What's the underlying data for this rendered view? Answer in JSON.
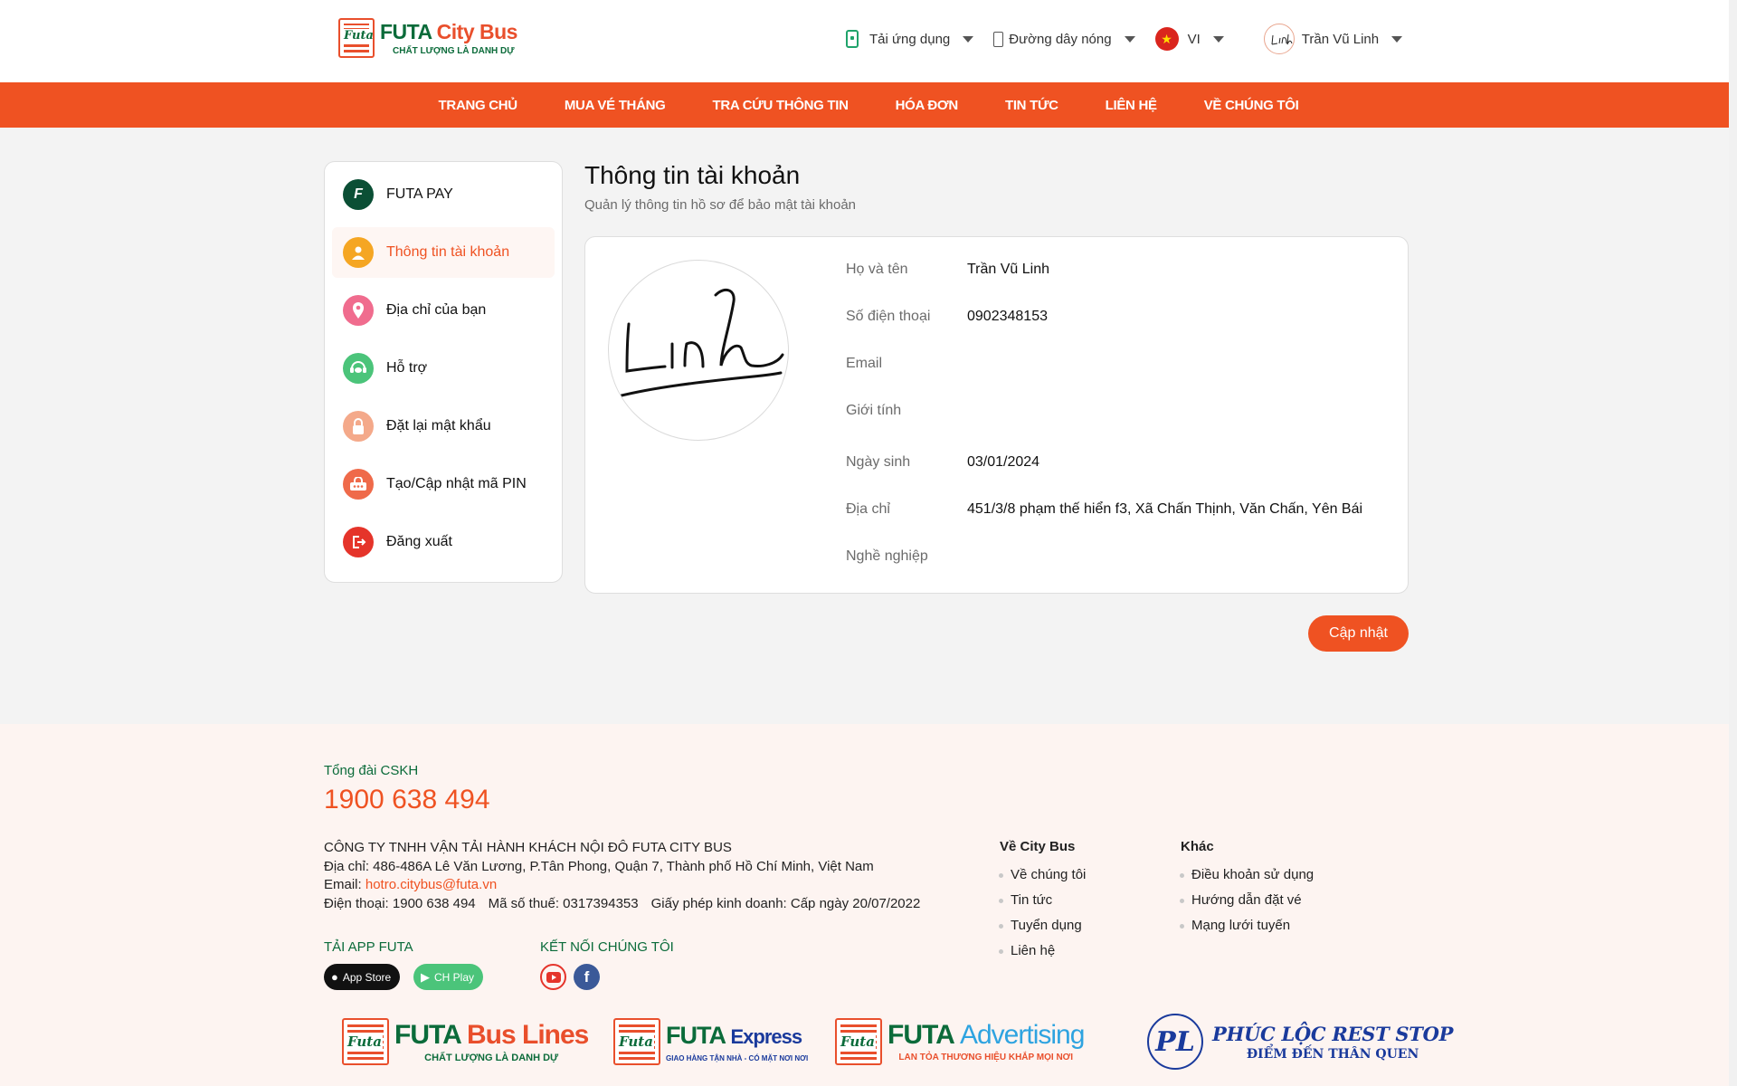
{
  "brand": {
    "logo_text": "Futa",
    "title_part1": "FUTA",
    "title_part2": "City Bus",
    "tagline": "CHẤT LƯỢNG LÀ DANH DỰ"
  },
  "topbar": {
    "app_download": "Tải ứng dụng",
    "hotline": "Đường dây nóng",
    "language": "VI",
    "user_name": "Trần Vũ Linh"
  },
  "nav": [
    "TRANG CHỦ",
    "MUA VÉ THÁNG",
    "TRA CỨU THÔNG TIN",
    "HÓA ĐƠN",
    "TIN TỨC",
    "LIÊN HỆ",
    "VỀ CHÚNG TÔI"
  ],
  "sidebar": [
    {
      "label": "FUTA PAY",
      "icon": "futa-pay-icon",
      "color": "#0b4f35"
    },
    {
      "label": "Thông tin tài khoản",
      "icon": "user-icon",
      "color": "#f5a623",
      "active": true
    },
    {
      "label": "Địa chỉ của bạn",
      "icon": "location-pin-icon",
      "color": "#f06c8e"
    },
    {
      "label": "Hỗ trợ",
      "icon": "support-chat-icon",
      "color": "#4bc47a"
    },
    {
      "label": "Đặt lại mật khẩu",
      "icon": "lock-icon",
      "color": "#f4a98a"
    },
    {
      "label": "Tạo/Cập nhật mã PIN",
      "icon": "pin-icon",
      "color": "#ef6a4a"
    },
    {
      "label": "Đăng xuất",
      "icon": "logout-icon",
      "color": "#e5342a"
    }
  ],
  "account": {
    "title": "Thông tin tài khoản",
    "subtitle": "Quản lý thông tin hồ sơ để bảo mật tài khoản",
    "fields": [
      {
        "label": "Họ và tên",
        "value": "Trần Vũ Linh"
      },
      {
        "label": "Số điện thoại",
        "value": "0902348153"
      },
      {
        "label": "Email",
        "value": ""
      },
      {
        "label": "Giới tính",
        "value": ""
      },
      {
        "label": "Ngày sinh",
        "value": "03/01/2024"
      },
      {
        "label": "Địa chỉ",
        "value": "451/3/8 phạm thế hiển f3, Xã Chấn Thịnh, Văn Chấn, Yên Bái"
      },
      {
        "label": "Nghề nghiệp",
        "value": ""
      }
    ],
    "avatar_signature": "Linh",
    "update_button": "Cập nhật"
  },
  "footer": {
    "hotline_label": "Tổng đài CSKH",
    "hotline": "1900 638 494",
    "company_name": "CÔNG TY TNHH VẬN TẢI HÀNH KHÁCH NỘI ĐÔ FUTA CITY BUS",
    "address": "Địa chỉ: 486-486A Lê Văn Lương, P.Tân Phong, Quận 7, Thành phố Hồ Chí Minh, Việt Nam",
    "email_label": "Email:",
    "email": "hotro.citybus@futa.vn",
    "phone": "Điện thoại: 1900 638 494",
    "tax": "Mã số thuế: 0317394353",
    "license": "Giấy phép kinh doanh: Cấp ngày 20/07/2022",
    "col1_title": "Về City Bus",
    "col1_links": [
      "Về chúng tôi",
      "Tin tức",
      "Tuyển dụng",
      "Liên hệ"
    ],
    "col2_title": "Khác",
    "col2_links": [
      "Điều khoản sử dụng",
      "Hướng dẫn đặt vé",
      "Mạng lưới tuyến"
    ],
    "app_title": "TẢI APP FUTA",
    "app_store": "App Store",
    "ch_play": "CH Play",
    "connect_title": "KẾT NỐI CHÚNG TÔI",
    "partners": {
      "buslines_a": "FUTA",
      "buslines_b": "Bus Lines",
      "buslines_sub": "CHẤT LƯỢNG LÀ DANH DỰ",
      "express_a": "FUTA",
      "express_b": "Express",
      "express_sub": "GIAO HÀNG TẬN NHÀ - CÓ MẶT NƠI NƠI",
      "adv_a": "FUTA",
      "adv_b": "Advertising",
      "adv_sub": "LAN TỎA THƯƠNG HIỆU KHẮP MỌI NƠI",
      "pl_mark": "PL",
      "pl_title": "PHÚC LỘC REST STOP",
      "pl_sub": "ĐIỂM ĐẾN THÂN QUEN"
    }
  }
}
